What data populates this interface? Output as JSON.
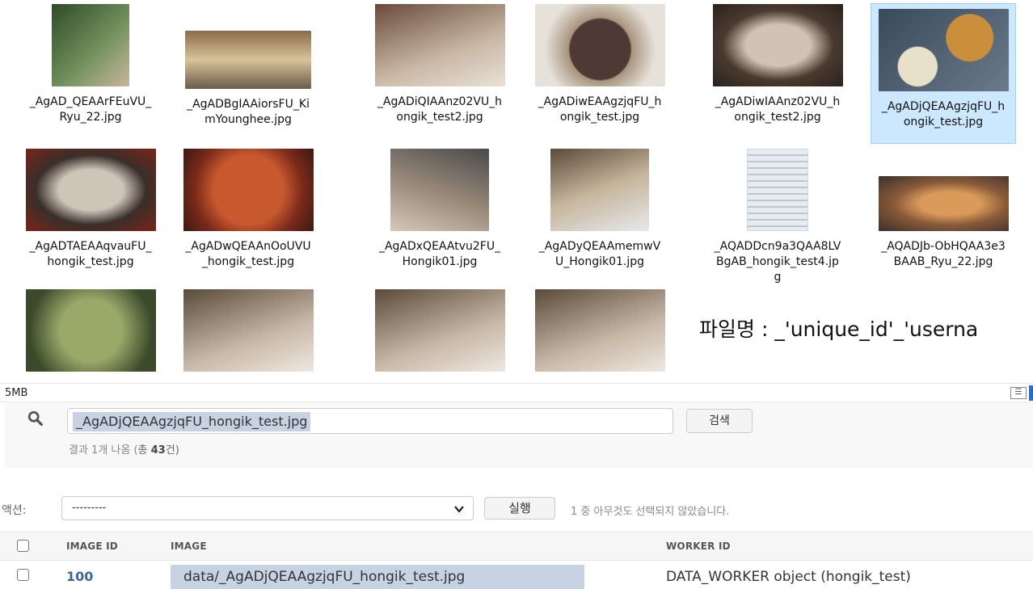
{
  "explorer": {
    "tiles": [
      {
        "name": "_AgAD_QEAArFEuVU_Ryu_22.jpg",
        "colors": [
          "#2f4a2a",
          "#6f8f5a"
        ]
      },
      {
        "name": "_AgADBgIAAiorsFU_KimYounghee.jpg",
        "colors": [
          "#8a6a4a",
          "#d8c39a"
        ]
      },
      {
        "name": "_AgADiQIAAnz02VU_hongik_test2.jpg",
        "colors": [
          "#6a4a3a",
          "#c9b8a5"
        ]
      },
      {
        "name": "_AgADiwEAAgzjqFU_hongik_test.jpg",
        "colors": [
          "#4e3a34",
          "#a8957e"
        ]
      },
      {
        "name": "_AgADiwIAAnz02VU_hongik_test2.jpg",
        "colors": [
          "#4a3a30",
          "#d0c2b4"
        ]
      },
      {
        "name": "_AgADjQEAAgzjqFU_hongik_test.jpg",
        "colors": [
          "#3a4a5a",
          "#c98f3a"
        ]
      },
      {
        "name": "_AgADTAEAAqvauFU_hongik_test.jpg",
        "colors": [
          "#3a2e2a",
          "#cfc4b8"
        ]
      },
      {
        "name": "_AgADwQEAAnOoUVU_hongik_test.jpg",
        "colors": [
          "#7a2a1a",
          "#c8582e"
        ]
      },
      {
        "name": "_AgADxQEAAtvu2FU_Hongik01.jpg",
        "colors": [
          "#4a4a4a",
          "#9b8b7b"
        ]
      },
      {
        "name": "_AgADyQEAAmemwVU_Hongik01.jpg",
        "colors": [
          "#5a4a3a",
          "#c5b59b"
        ]
      },
      {
        "name": "_AQADDcn9a3QAA8LVBgAB_hongik_test4.jpg",
        "colors": [
          "#e8ecf0",
          "#6f8aa8"
        ]
      },
      {
        "name": "_AQADJb-ObHQAA3e3BAAB_Ryu_22.jpg",
        "colors": [
          "#5a4a3a",
          "#d99a5a"
        ]
      },
      {
        "name": "",
        "colors": [
          "#3a4a2a",
          "#9aa86a"
        ]
      },
      {
        "name": "",
        "colors": [
          "#5a4a3a",
          "#c8b8a8"
        ]
      },
      {
        "name": "",
        "colors": [
          "#5a4a3a",
          "#c8b8a8"
        ]
      },
      {
        "name": "",
        "colors": [
          "#5a4a3a",
          "#c8b8a8"
        ]
      }
    ],
    "note": "파일명 : _'unique_id'_'userna",
    "status_size": "5MB"
  },
  "search": {
    "query": "_AgADjQEAAgzjqFU_hongik_test.jpg",
    "button": "검색",
    "result_prefix": "결과 1개 나옴 (",
    "result_total_label": "총 ",
    "result_total": "43",
    "result_suffix": "건)"
  },
  "actions": {
    "label": "액션:",
    "selected": "---------",
    "go": "실행",
    "count_text": "1 중 아무것도 선택되지 않았습니다."
  },
  "table": {
    "headers": [
      "IMAGE ID",
      "IMAGE",
      "WORKER ID"
    ],
    "rows": [
      {
        "id": "100",
        "image": "data/_AgADjQEAAgzjqFU_hongik_test.jpg",
        "worker": "DATA_WORKER object (hongik_test)"
      }
    ]
  }
}
